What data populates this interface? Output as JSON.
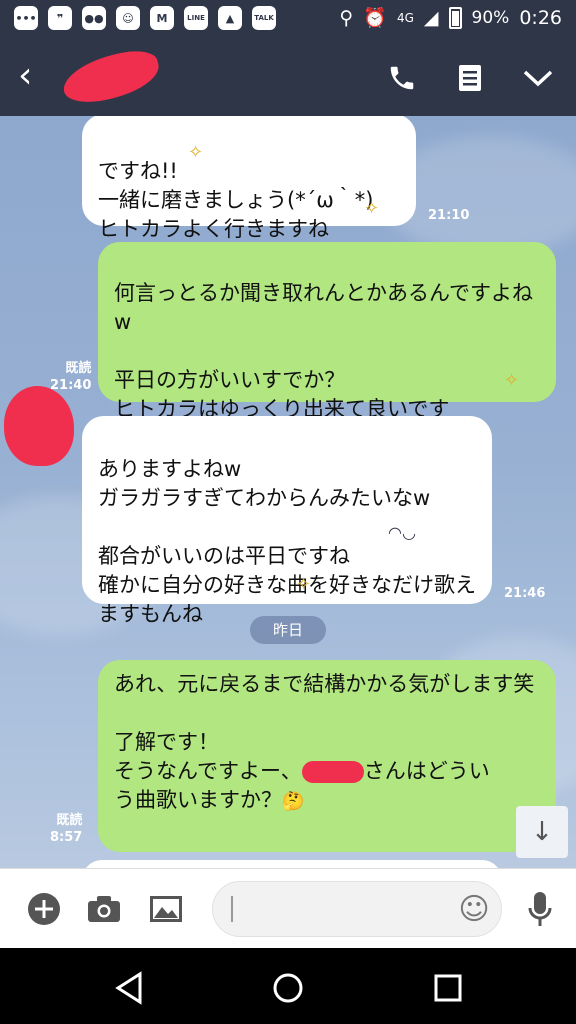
{
  "status_bar": {
    "signal_label": "4G",
    "battery_percent": "90%",
    "time": "0:26",
    "notification_icons": [
      "chat-bubble-icon",
      "quote-icon",
      "chat-double-icon",
      "person-card-icon",
      "m-logo-icon",
      "line-icon",
      "image-icon",
      "talk-icon"
    ],
    "line_label": "LINE",
    "talk_label": "TALK"
  },
  "header": {
    "back_icon": "chevron-left-icon",
    "call_icon": "phone-icon",
    "menu_icon": "notes-icon",
    "more_icon": "chevron-down-icon"
  },
  "chat": {
    "messages": [
      {
        "side": "in",
        "text": "ですね!!\n一緒に磨きましょう(*´ω｀*)\nヒトカラよく行きますね",
        "time": "21:10"
      },
      {
        "side": "out",
        "text": "何言っとるか聞き取れんとかあるんですよねw\n\n平日の方がいいすでか？\nヒトカラはゆっくり出来て良いです",
        "read": "既読",
        "time": "21:40"
      },
      {
        "side": "in",
        "text": "ありますよねw\nガラガラすぎてわからんみたいなw\n\n都合がいいのは平日ですね\n確かに自分の好きな曲を好きなだけ歌えますもんね",
        "time": "21:46"
      },
      {
        "side": "out",
        "text_before": "あれ、元に戻るまで結構かかる気がします笑\n\n了解です！\nそうなんですよー、",
        "text_after": "さんはどうい\nう曲歌いますか？",
        "read": "既読",
        "time": "8:57"
      }
    ],
    "date_separator": "昨日"
  },
  "input_bar": {
    "placeholder": "",
    "plus_icon": "plus-icon",
    "camera_icon": "camera-icon",
    "image_icon": "image-icon",
    "emoji_icon": "smile-icon",
    "mic_icon": "microphone-icon"
  },
  "colors": {
    "header_bg": "#2e3648",
    "bubble_out": "#b1e680",
    "bubble_in": "#ffffff",
    "redaction": "#ef2f4d"
  }
}
